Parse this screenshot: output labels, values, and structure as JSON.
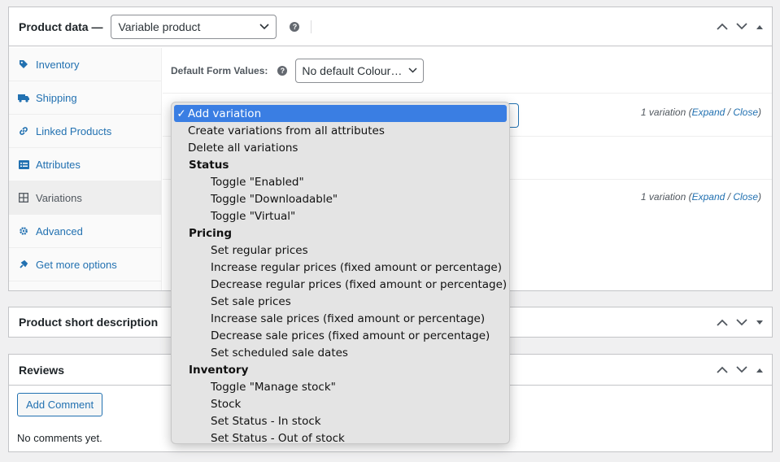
{
  "product_data": {
    "title": "Product data —",
    "type_select": "Variable product",
    "help": "?",
    "tabs": [
      {
        "label": "Inventory",
        "icon": "tag-icon"
      },
      {
        "label": "Shipping",
        "icon": "truck-icon"
      },
      {
        "label": "Linked Products",
        "icon": "link-icon"
      },
      {
        "label": "Attributes",
        "icon": "list-icon"
      },
      {
        "label": "Variations",
        "icon": "grid-icon",
        "active": true
      },
      {
        "label": "Advanced",
        "icon": "gear-icon"
      },
      {
        "label": "Get more options",
        "icon": "plugin-icon"
      }
    ],
    "default_form_label": "Default Form Values:",
    "default_form_select": "No default Colour…",
    "variation_count_1": {
      "count": "1 variation (",
      "expand": "Expand",
      "sep": " / ",
      "close": "Close",
      "end": ")"
    },
    "variation_count_2": {
      "count": "1 variation (",
      "expand": "Expand",
      "sep": " / ",
      "close": "Close",
      "end": ")"
    }
  },
  "short_description": {
    "title": "Product short description"
  },
  "reviews": {
    "title": "Reviews",
    "add_comment": "Add Comment",
    "empty": "No comments yet."
  },
  "dropdown": {
    "selected": "Add variation",
    "items": [
      {
        "label": "Create variations from all attributes",
        "level": 0
      },
      {
        "label": "Delete all variations",
        "level": 0
      },
      {
        "label": "Status",
        "level": "group"
      },
      {
        "label": "Toggle \"Enabled\"",
        "level": 1
      },
      {
        "label": "Toggle \"Downloadable\"",
        "level": 1
      },
      {
        "label": "Toggle \"Virtual\"",
        "level": 1
      },
      {
        "label": "Pricing",
        "level": "group"
      },
      {
        "label": "Set regular prices",
        "level": 1
      },
      {
        "label": "Increase regular prices (fixed amount or percentage)",
        "level": 1
      },
      {
        "label": "Decrease regular prices (fixed amount or percentage)",
        "level": 1
      },
      {
        "label": "Set sale prices",
        "level": 1
      },
      {
        "label": "Increase sale prices (fixed amount or percentage)",
        "level": 1
      },
      {
        "label": "Decrease sale prices (fixed amount or percentage)",
        "level": 1
      },
      {
        "label": "Set scheduled sale dates",
        "level": 1
      },
      {
        "label": "Inventory",
        "level": "group"
      },
      {
        "label": "Toggle \"Manage stock\"",
        "level": 1
      },
      {
        "label": "Stock",
        "level": 1
      },
      {
        "label": "Set Status - In stock",
        "level": 1
      },
      {
        "label": "Set Status - Out of stock",
        "level": 1
      }
    ]
  },
  "colors": {
    "link": "#2271b1",
    "selected": "#3a7ee3"
  }
}
